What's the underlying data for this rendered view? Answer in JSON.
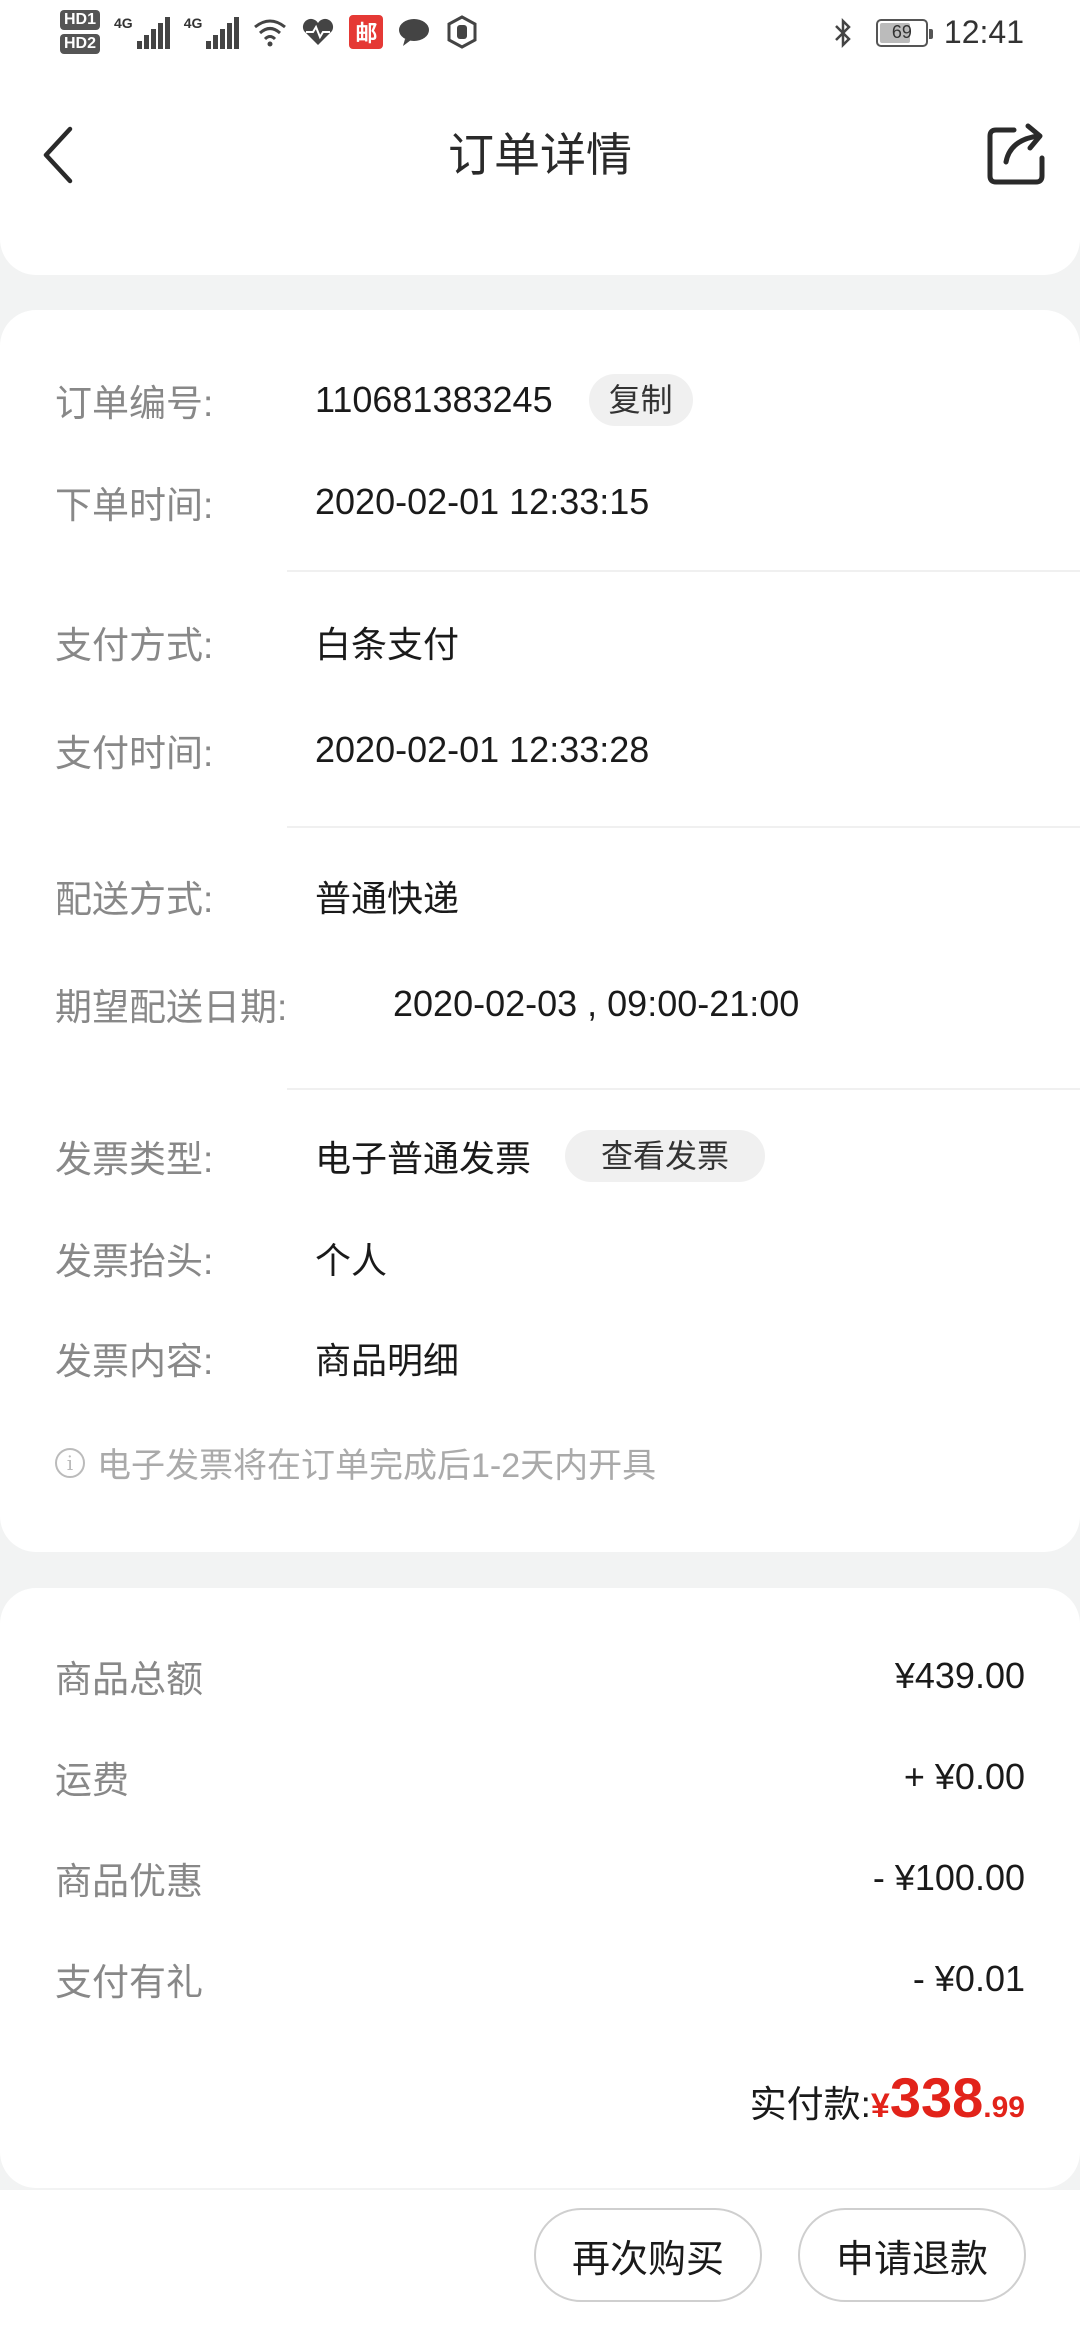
{
  "status_bar": {
    "hd1": "HD1",
    "hd2": "HD2",
    "net1": "4G",
    "net2": "4G",
    "battery": "69",
    "battery_level_percent": 69,
    "time": "12:41",
    "mail_badge": "邮"
  },
  "header": {
    "title": "订单详情"
  },
  "order_info": {
    "order_no_label": "订单编号:",
    "order_no": "110681383245",
    "copy_label": "复制",
    "order_time_label": "下单时间:",
    "order_time": "2020-02-01 12:33:15",
    "pay_method_label": "支付方式:",
    "pay_method": "白条支付",
    "pay_time_label": "支付时间:",
    "pay_time": "2020-02-01 12:33:28",
    "delivery_method_label": "配送方式:",
    "delivery_method": "普通快递",
    "expected_date_label": "期望配送日期:",
    "expected_date": "2020-02-03 , 09:00-21:00",
    "invoice_type_label": "发票类型:",
    "invoice_type": "电子普通发票",
    "view_invoice_label": "查看发票",
    "invoice_title_label": "发票抬头:",
    "invoice_title": "个人",
    "invoice_content_label": "发票内容:",
    "invoice_content": "商品明细",
    "invoice_note": "电子发票将在订单完成后1-2天内开具"
  },
  "price_info": {
    "items": [
      {
        "label": "商品总额",
        "value": "¥439.00"
      },
      {
        "label": "运费",
        "value": "+ ¥0.00"
      },
      {
        "label": "商品优惠",
        "value": "- ¥100.00"
      },
      {
        "label": "支付有礼",
        "value": "- ¥0.01"
      }
    ],
    "paid_label": "实付款:",
    "paid_symbol": "¥",
    "paid_integer": "338",
    "paid_decimal": ".99"
  },
  "actions": {
    "rebuy_label": "再次购买",
    "refund_label": "申请退款"
  },
  "colors": {
    "accent_red": "#e2231a",
    "label_gray": "#888888",
    "page_bg": "#f2f3f3"
  }
}
